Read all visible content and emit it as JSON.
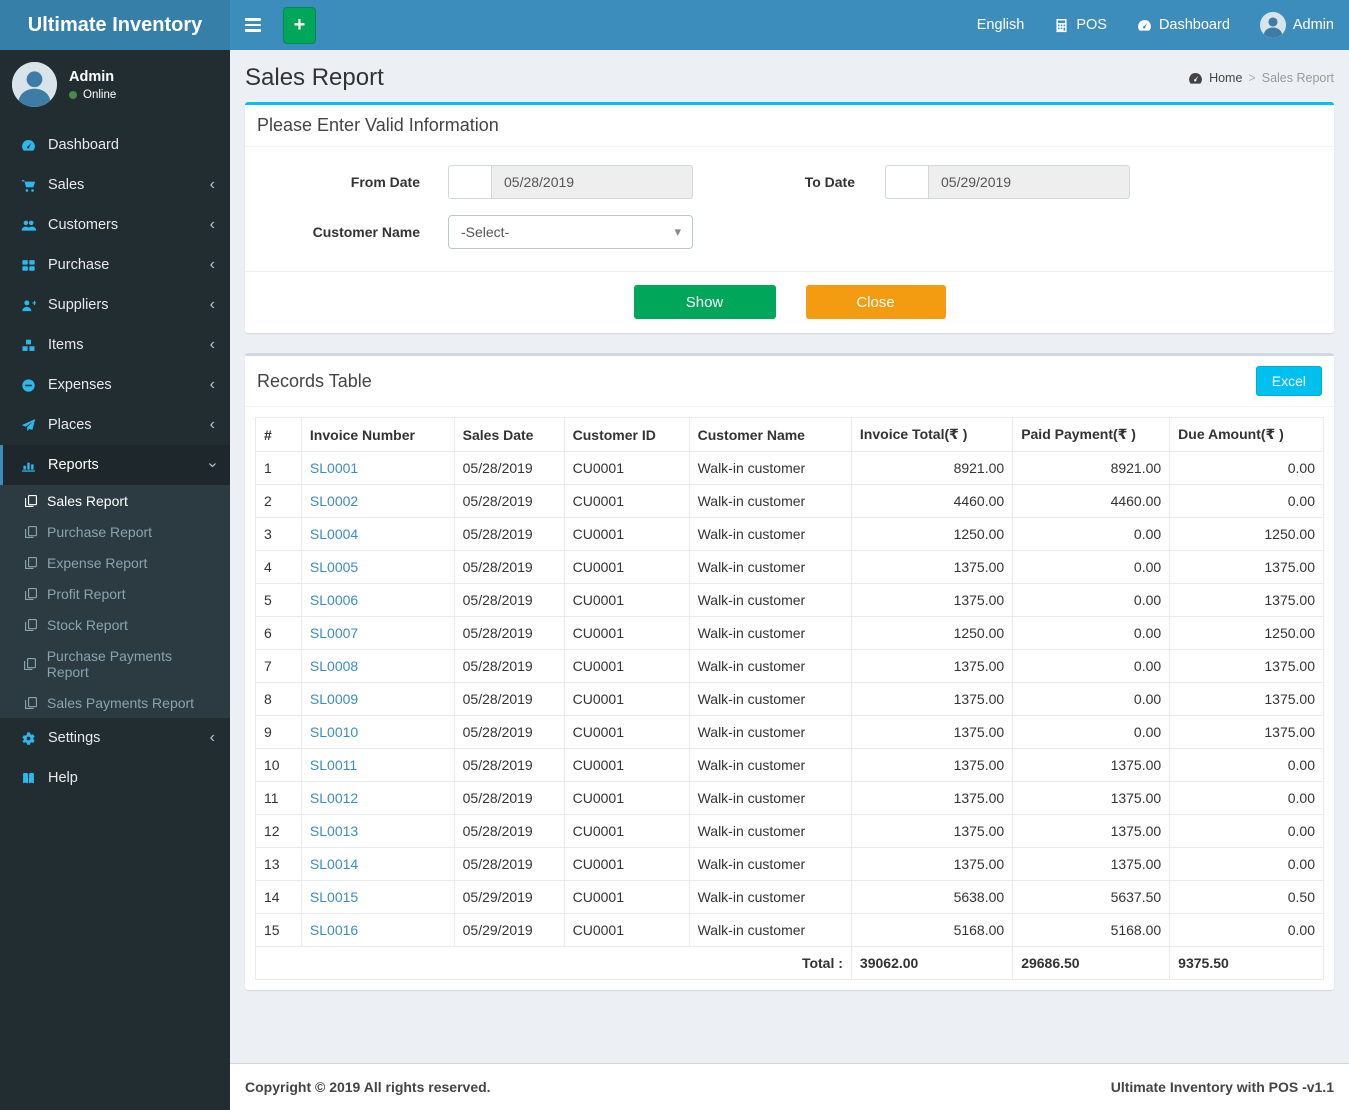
{
  "colors": {
    "navbar_bg": "#3c8dbc",
    "brand_bg": "#367fa9",
    "sidebar_bg": "#222d32",
    "submenu_bg": "#2c3b41",
    "accent": "#00c0ef",
    "success": "#00a65a",
    "warning": "#f39c12",
    "link": "#3c8dbc",
    "sidebar_icon": "#2cb8e8",
    "online": "#4a8b4a",
    "content_bg": "#ecf0f5"
  },
  "navbar": {
    "brand": "Ultimate Inventory",
    "menu_right": [
      {
        "label": "English",
        "icon": null
      },
      {
        "label": "POS",
        "icon": "calculator-icon"
      },
      {
        "label": "Dashboard",
        "icon": "gauge-icon"
      },
      {
        "label": "Admin",
        "icon": "avatar-icon"
      }
    ]
  },
  "sidebar": {
    "user": {
      "name": "Admin",
      "status": "Online"
    },
    "items": [
      {
        "label": "Dashboard",
        "icon": "gauge-icon",
        "chevron": null
      },
      {
        "label": "Sales",
        "icon": "cart-icon",
        "chevron": "left"
      },
      {
        "label": "Customers",
        "icon": "users-icon",
        "chevron": "left"
      },
      {
        "label": "Purchase",
        "icon": "grid-icon",
        "chevron": "left"
      },
      {
        "label": "Suppliers",
        "icon": "user-plus-icon",
        "chevron": "left"
      },
      {
        "label": "Items",
        "icon": "cubes-icon",
        "chevron": "left"
      },
      {
        "label": "Expenses",
        "icon": "minus-circle-icon",
        "chevron": "left"
      },
      {
        "label": "Places",
        "icon": "paper-plane-icon",
        "chevron": "left"
      },
      {
        "label": "Reports",
        "icon": "bar-chart-icon",
        "chevron": "down",
        "active": true,
        "submenu": [
          {
            "label": "Sales Report",
            "active": true
          },
          {
            "label": "Purchase Report"
          },
          {
            "label": "Expense Report"
          },
          {
            "label": "Profit Report"
          },
          {
            "label": "Stock Report"
          },
          {
            "label": "Purchase Payments Report"
          },
          {
            "label": "Sales Payments Report"
          }
        ]
      },
      {
        "label": "Settings",
        "icon": "gears-icon",
        "chevron": "left"
      },
      {
        "label": "Help",
        "icon": "book-icon",
        "chevron": null
      }
    ]
  },
  "page": {
    "title": "Sales Report",
    "breadcrumb": {
      "home": "Home",
      "separator": ">",
      "current": "Sales Report"
    }
  },
  "filter": {
    "panel_title": "Please Enter Valid Information",
    "from_date": {
      "label": "From Date",
      "value": "05/28/2019"
    },
    "to_date": {
      "label": "To Date",
      "value": "05/29/2019"
    },
    "customer": {
      "label": "Customer Name",
      "value": "-Select-"
    },
    "show_label": "Show",
    "close_label": "Close"
  },
  "records": {
    "panel_title": "Records Table",
    "excel_label": "Excel",
    "columns": [
      "#",
      "Invoice Number",
      "Sales Date",
      "Customer ID",
      "Customer Name",
      "Invoice Total(₹ )",
      "Paid Payment(₹ )",
      "Due Amount(₹ )"
    ],
    "rows": [
      [
        "1",
        "SL0001",
        "05/28/2019",
        "CU0001",
        "Walk-in customer",
        "8921.00",
        "8921.00",
        "0.00"
      ],
      [
        "2",
        "SL0002",
        "05/28/2019",
        "CU0001",
        "Walk-in customer",
        "4460.00",
        "4460.00",
        "0.00"
      ],
      [
        "3",
        "SL0004",
        "05/28/2019",
        "CU0001",
        "Walk-in customer",
        "1250.00",
        "0.00",
        "1250.00"
      ],
      [
        "4",
        "SL0005",
        "05/28/2019",
        "CU0001",
        "Walk-in customer",
        "1375.00",
        "0.00",
        "1375.00"
      ],
      [
        "5",
        "SL0006",
        "05/28/2019",
        "CU0001",
        "Walk-in customer",
        "1375.00",
        "0.00",
        "1375.00"
      ],
      [
        "6",
        "SL0007",
        "05/28/2019",
        "CU0001",
        "Walk-in customer",
        "1250.00",
        "0.00",
        "1250.00"
      ],
      [
        "7",
        "SL0008",
        "05/28/2019",
        "CU0001",
        "Walk-in customer",
        "1375.00",
        "0.00",
        "1375.00"
      ],
      [
        "8",
        "SL0009",
        "05/28/2019",
        "CU0001",
        "Walk-in customer",
        "1375.00",
        "0.00",
        "1375.00"
      ],
      [
        "9",
        "SL0010",
        "05/28/2019",
        "CU0001",
        "Walk-in customer",
        "1375.00",
        "0.00",
        "1375.00"
      ],
      [
        "10",
        "SL0011",
        "05/28/2019",
        "CU0001",
        "Walk-in customer",
        "1375.00",
        "1375.00",
        "0.00"
      ],
      [
        "11",
        "SL0012",
        "05/28/2019",
        "CU0001",
        "Walk-in customer",
        "1375.00",
        "1375.00",
        "0.00"
      ],
      [
        "12",
        "SL0013",
        "05/28/2019",
        "CU0001",
        "Walk-in customer",
        "1375.00",
        "1375.00",
        "0.00"
      ],
      [
        "13",
        "SL0014",
        "05/28/2019",
        "CU0001",
        "Walk-in customer",
        "1375.00",
        "1375.00",
        "0.00"
      ],
      [
        "14",
        "SL0015",
        "05/29/2019",
        "CU0001",
        "Walk-in customer",
        "5638.00",
        "5637.50",
        "0.50"
      ],
      [
        "15",
        "SL0016",
        "05/29/2019",
        "CU0001",
        "Walk-in customer",
        "5168.00",
        "5168.00",
        "0.00"
      ]
    ],
    "total": {
      "label": "Total :",
      "invoice_total": "39062.00",
      "paid": "29686.50",
      "due": "9375.50"
    }
  },
  "footer": {
    "left": "Copyright © 2019 All rights reserved.",
    "right": "Ultimate Inventory with POS -v1.1"
  }
}
